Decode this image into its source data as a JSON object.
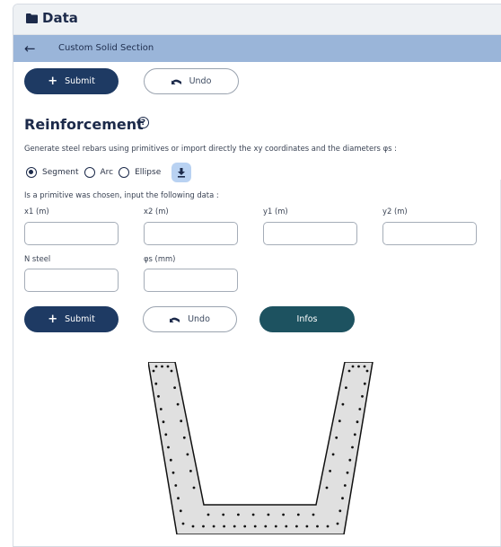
{
  "header": {
    "title": "Data",
    "icon": "folder-icon"
  },
  "subheader": {
    "back_icon": "arrow-left-icon",
    "title": "Custom Solid Section"
  },
  "top_actions": {
    "submit_label": "Submit",
    "undo_label": "Undo"
  },
  "reinforcement": {
    "title": "Reinforcement",
    "description": "Generate steel rebars using primitives or import directly the xy coordinates and the diameters φs :",
    "primitives": [
      "Segment",
      "Arc",
      "Ellipse"
    ],
    "selected_primitive": "Segment",
    "import_icon": "download-icon",
    "instruction": "Is a primitive was chosen, input the following data :",
    "fields": {
      "x1": {
        "label": "x1 (m)",
        "value": ""
      },
      "x2": {
        "label": "x2 (m)",
        "value": ""
      },
      "y1": {
        "label": "y1 (m)",
        "value": ""
      },
      "y2": {
        "label": "y2 (m)",
        "value": ""
      },
      "n_steel": {
        "label": "N steel",
        "value": ""
      },
      "phi_s": {
        "label": "φs (mm)",
        "value": ""
      }
    },
    "submit_label": "Submit",
    "undo_label": "Undo",
    "infos_label": "Infos"
  },
  "colors": {
    "primary": "#1e3a63",
    "teal": "#1d5260",
    "subheader_bg": "#9ab5d9",
    "section_fill": "#e0e0e0"
  }
}
